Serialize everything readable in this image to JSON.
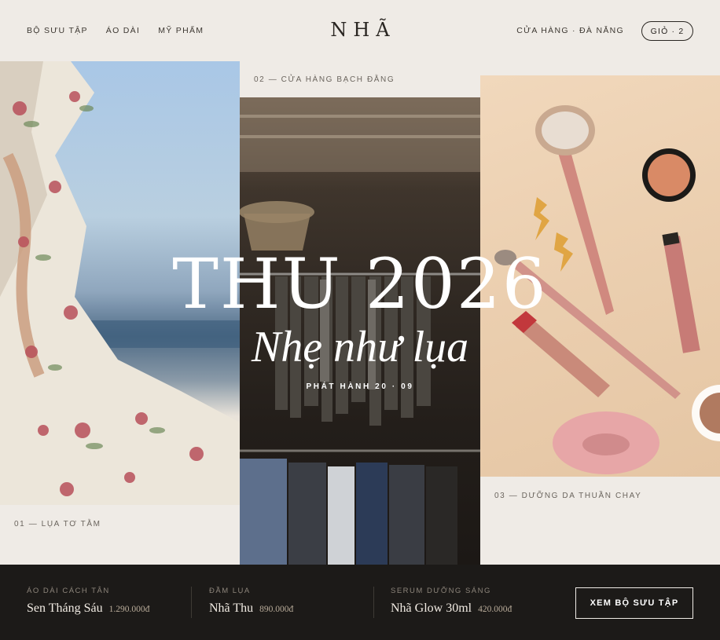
{
  "header": {
    "nav": [
      "BỘ SƯU TẬP",
      "ÁO DÀI",
      "MỸ PHẨM"
    ],
    "logo": "NHÃ",
    "store": "CỬA HÀNG · ĐÀ NẴNG",
    "cart": "GIỎ · 2"
  },
  "panels": [
    {
      "caption": "01 — LỤA TƠ TẰM",
      "image": "silk-floral-dress-photo"
    },
    {
      "caption": "02 — CỬA HÀNG BẠCH ĐẰNG",
      "image": "boutique-clothing-rack-photo"
    },
    {
      "caption": "03 — DƯỠNG DA THUẦN CHAY",
      "image": "cosmetics-flatlay-photo"
    }
  ],
  "hero": {
    "title": "THU 2026",
    "subtitle": "Nhẹ như lụa",
    "release": "PHÁT HÀNH 20 · 09"
  },
  "products": [
    {
      "category": "ÁO DÀI CÁCH TÂN",
      "name": "Sen Tháng Sáu",
      "price": "1.290.000đ"
    },
    {
      "category": "ĐẦM LỤA",
      "name": "Nhã Thu",
      "price": "890.000đ"
    },
    {
      "category": "SERUM DƯỠNG SÁNG",
      "name": "Nhã Glow 30ml",
      "price": "420.000đ"
    }
  ],
  "cta": "XEM BỘ SƯU TẬP",
  "colors": {
    "background": "#efebe6",
    "dark": "#1c1a18",
    "text": "#2a2622"
  }
}
